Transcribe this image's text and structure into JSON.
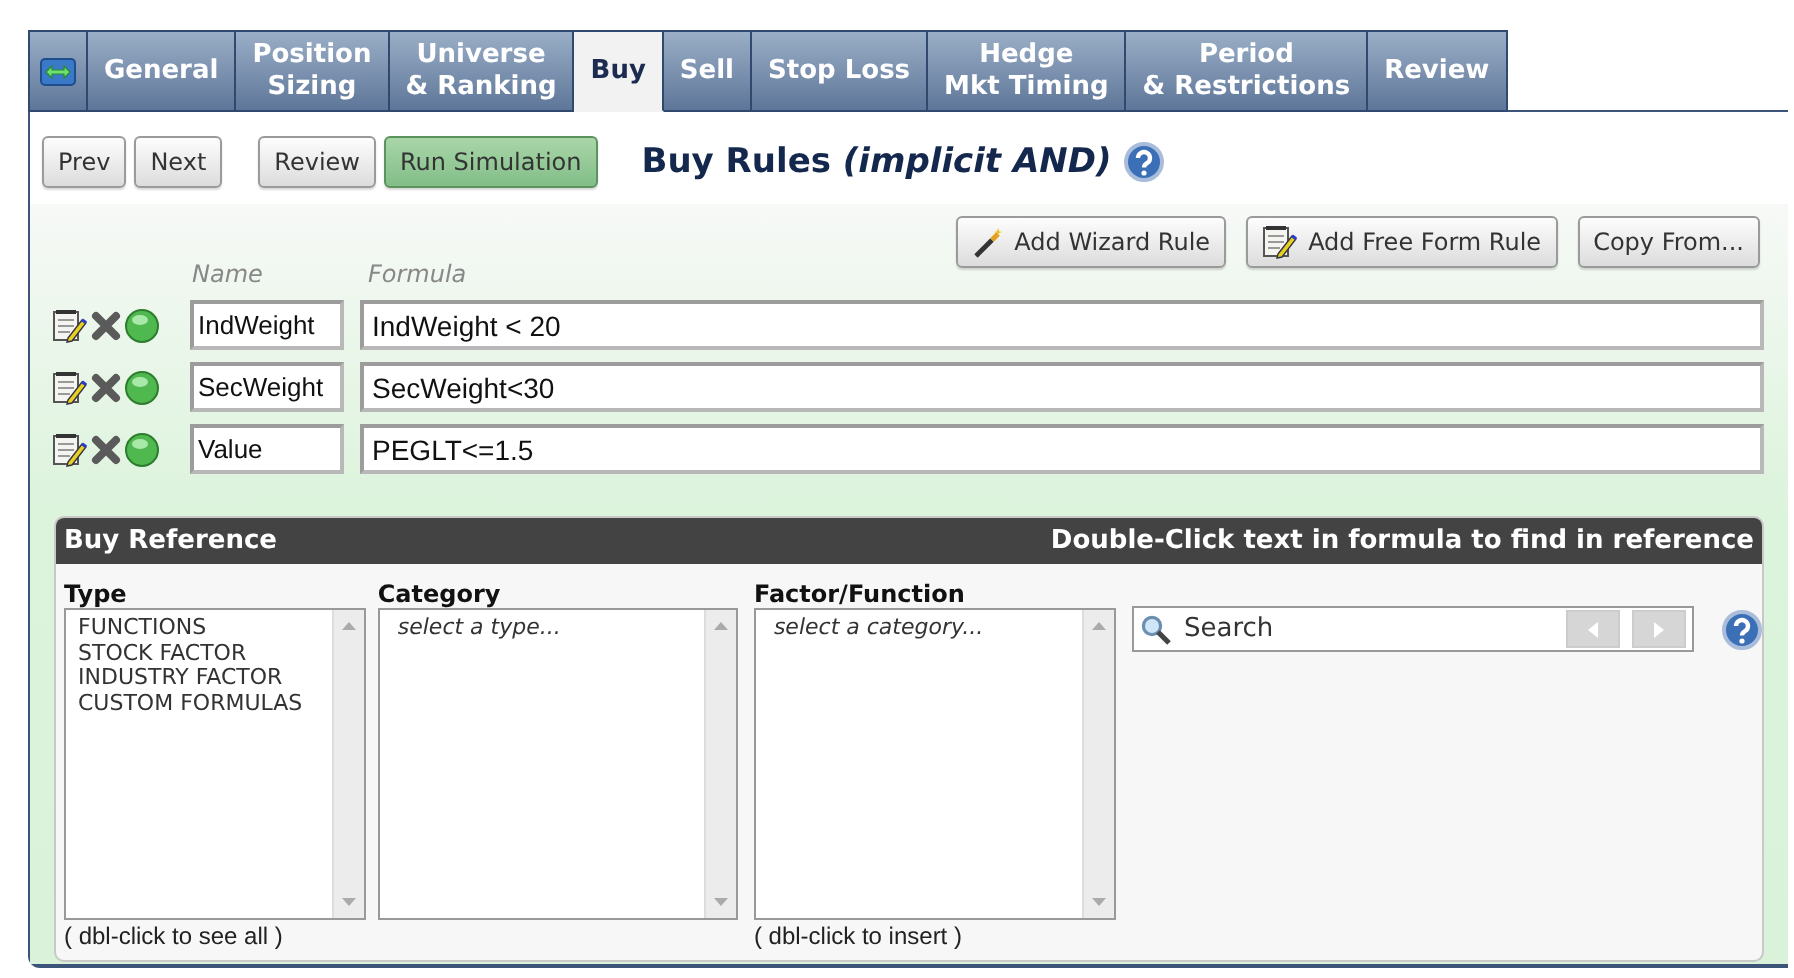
{
  "tabs": [
    {
      "kind": "icon",
      "selected": false
    },
    {
      "kind": "text",
      "label": "General",
      "selected": false
    },
    {
      "kind": "text",
      "label": "Position\nSizing",
      "selected": false
    },
    {
      "kind": "text",
      "label": "Universe\n& Ranking",
      "selected": false
    },
    {
      "kind": "text",
      "label": "Buy",
      "selected": true
    },
    {
      "kind": "text",
      "label": "Sell",
      "selected": false
    },
    {
      "kind": "text",
      "label": "Stop Loss",
      "selected": false
    },
    {
      "kind": "text",
      "label": "Hedge\nMkt Timing",
      "selected": false
    },
    {
      "kind": "text",
      "label": "Period\n& Restrictions",
      "selected": false
    },
    {
      "kind": "text",
      "label": "Review",
      "selected": false
    }
  ],
  "toolbar": {
    "buttons": [
      {
        "label": "Prev",
        "kind": "default"
      },
      {
        "label": "Next",
        "kind": "default"
      },
      {
        "label": "Review",
        "kind": "spaced"
      },
      {
        "label": "Run Simulation",
        "kind": "primary"
      }
    ],
    "title": "Buy Rules *(implicit AND)*"
  },
  "rules": {
    "actions": [
      {
        "label": "Add Wizard Rule",
        "kind": "wizard"
      },
      {
        "label": "Add Free Form Rule",
        "kind": "freeform"
      },
      {
        "label": "Copy From...",
        "kind": "plain"
      }
    ],
    "columns": [
      "Name",
      "Formula"
    ],
    "rows": [
      {
        "name": "IndWeight",
        "formula": "IndWeight < 20",
        "enabled": true
      },
      {
        "name": "SecWeight",
        "formula": "SecWeight<30",
        "enabled": true
      },
      {
        "name": "Value",
        "formula": "PEGLT<=1.5",
        "enabled": true
      }
    ]
  },
  "reference": {
    "title": "Buy Reference",
    "hint": "Double-Click text in formula to find in reference",
    "lists": [
      {
        "heading": "Type",
        "items": [
          "FUNCTIONS",
          "STOCK FACTOR",
          "INDUSTRY FACTOR",
          "CUSTOM FORMULAS"
        ],
        "footer": "( dbl-click to see all )"
      },
      {
        "heading": "Category",
        "hint": "select a type..."
      },
      {
        "heading": "Factor/Function",
        "hint": "select a category...",
        "footer": "( dbl-click to insert )"
      }
    ],
    "search": {
      "placeholder": "Search"
    }
  }
}
